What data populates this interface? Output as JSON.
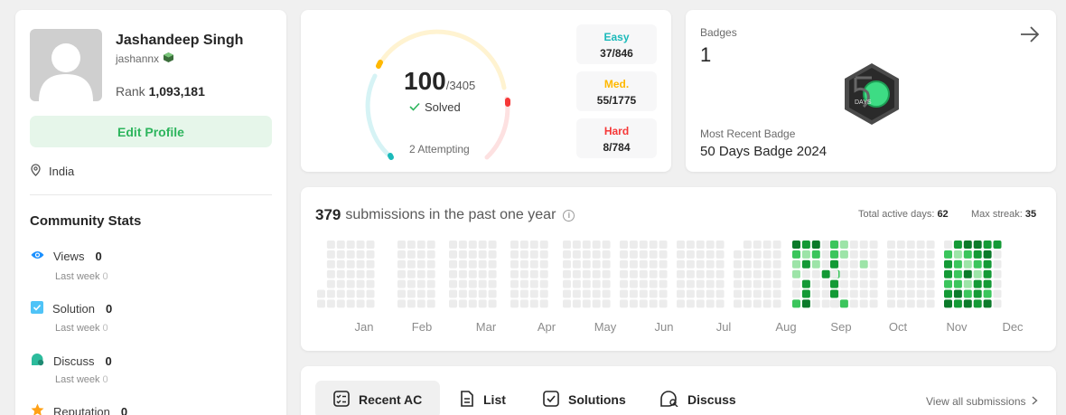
{
  "profile": {
    "name": "Jashandeep Singh",
    "handle": "jashannx",
    "rank_label": "Rank",
    "rank_value": "1,093,181",
    "edit_label": "Edit Profile",
    "location": "India"
  },
  "community": {
    "title": "Community Stats",
    "stats": [
      {
        "label": "Views",
        "value": "0",
        "sub_label": "Last week",
        "sub_value": "0",
        "color": "#1a90ff"
      },
      {
        "label": "Solution",
        "value": "0",
        "sub_label": "Last week",
        "sub_value": "0",
        "color": "#4fc3f7"
      },
      {
        "label": "Discuss",
        "value": "0",
        "sub_label": "Last week",
        "sub_value": "0",
        "color": "#2cbb9c"
      },
      {
        "label": "Reputation",
        "value": "0",
        "color": "#ffa116"
      }
    ]
  },
  "solved": {
    "count": "100",
    "total": "/3405",
    "label": "Solved",
    "attempting": "2 Attempting",
    "difficulties": [
      {
        "label": "Easy",
        "value": "37/846",
        "color": "#1cbaba"
      },
      {
        "label": "Med.",
        "value": "55/1775",
        "color": "#ffb800"
      },
      {
        "label": "Hard",
        "value": "8/784",
        "color": "#f63737"
      }
    ]
  },
  "badges": {
    "label": "Badges",
    "count": "1",
    "recent_label": "Most Recent Badge",
    "recent_name": "50 Days Badge 2024"
  },
  "submissions": {
    "count": "379",
    "text": "submissions in the past one year",
    "active_label": "Total active days:",
    "active_value": "62",
    "streak_label": "Max streak:",
    "streak_value": "35",
    "months": [
      "Jan",
      "Feb",
      "Mar",
      "Apr",
      "May",
      "Jun",
      "Jul",
      "Aug",
      "Sep",
      "Oct",
      "Nov",
      "Dec"
    ]
  },
  "tabs": {
    "items": [
      {
        "label": "Recent AC",
        "icon": "recent-ac-icon"
      },
      {
        "label": "List",
        "icon": "list-icon"
      },
      {
        "label": "Solutions",
        "icon": "solutions-icon"
      },
      {
        "label": "Discuss",
        "icon": "discuss-icon"
      }
    ],
    "view_all": "View all submissions"
  }
}
